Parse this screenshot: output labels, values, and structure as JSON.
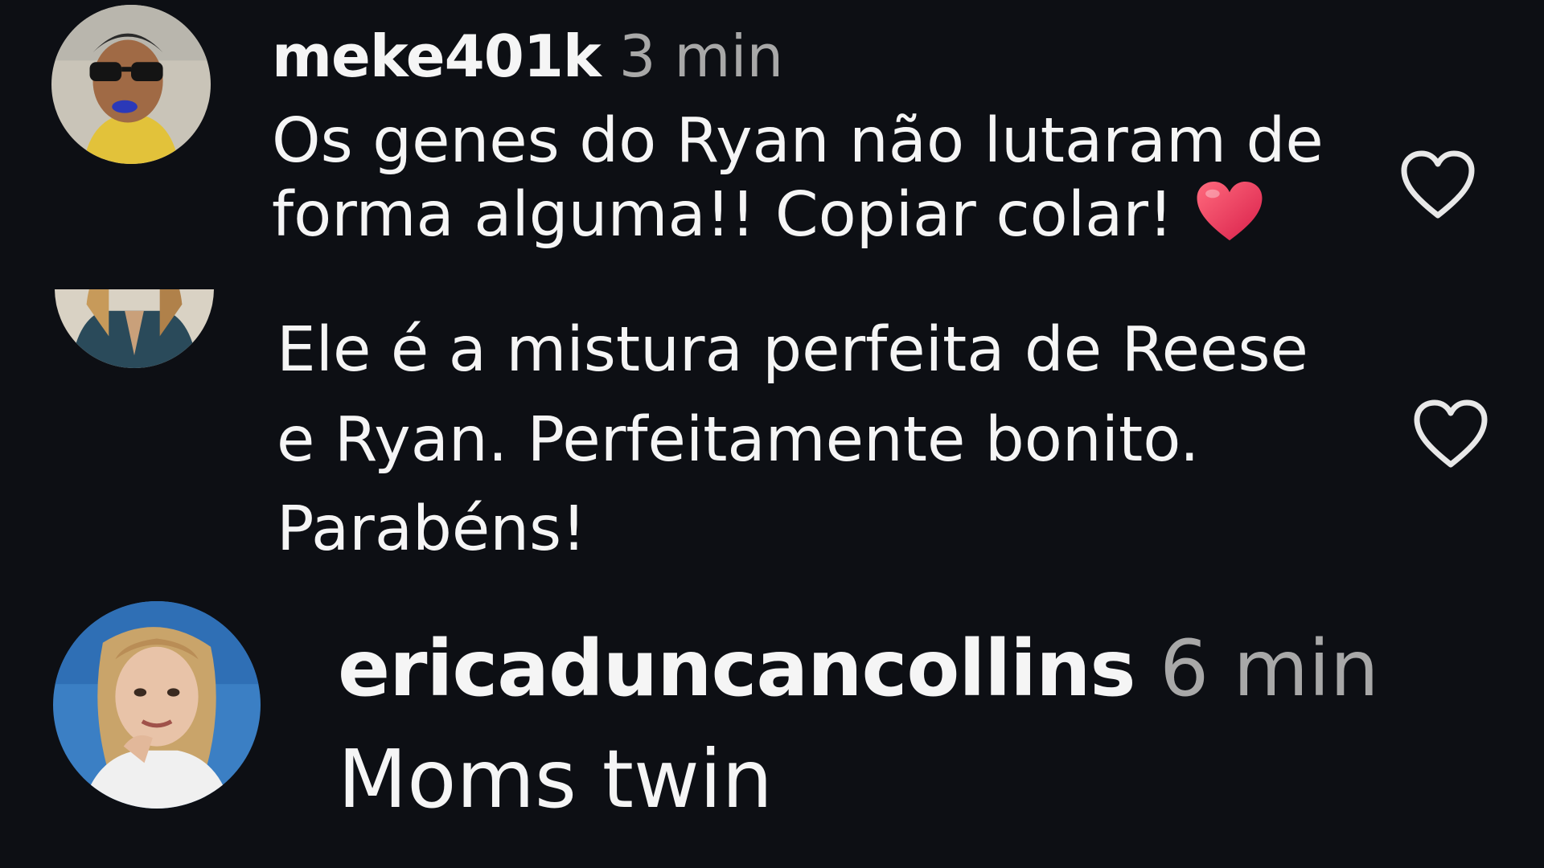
{
  "comments": [
    {
      "username": "meke401k",
      "time": "3 min",
      "text": "Os genes do Ryan não lutaram de forma alguma!! Copiar colar!",
      "emoji": "red-heart-emoji",
      "like_icon": "heart-outline-icon"
    },
    {
      "text": "Ele é a mistura perfeita de Reese e Ryan. Perfeitamente bonito. Parabéns!",
      "like_icon": "heart-outline-icon"
    },
    {
      "username": "ericaduncancollins",
      "time": "6 min",
      "text": "Moms twin"
    }
  ],
  "colors": {
    "background": "#0d0f14",
    "text": "#f5f5f5",
    "muted": "#a8a8a8",
    "emoji_heart": "#f0385a"
  }
}
